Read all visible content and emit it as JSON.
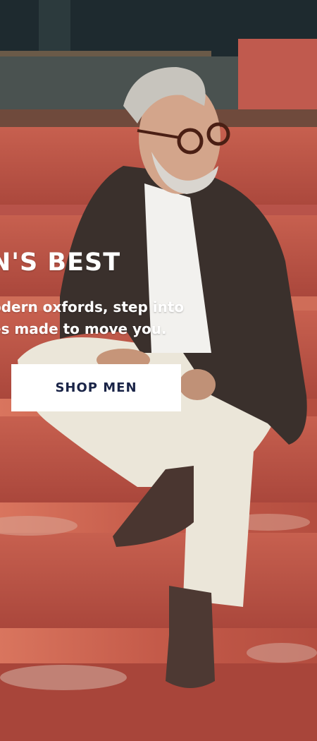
{
  "hero": {
    "headline": "N'S BEST",
    "subcopy_line1": "odern oxfords, step into",
    "subcopy_line2": "es made to move you.",
    "cta_label": "SHOP MEN"
  },
  "colors": {
    "steps": "#c0574a",
    "button_text": "#1a2447",
    "button_bg": "#ffffff"
  }
}
